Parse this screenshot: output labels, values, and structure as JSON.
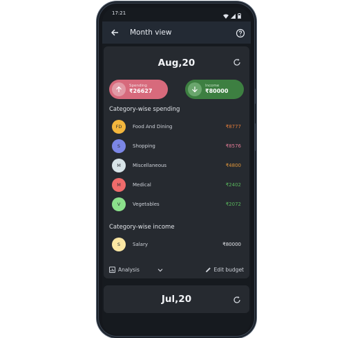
{
  "status_bar": {
    "time": "17:21"
  },
  "app_bar": {
    "title": "Month view"
  },
  "month_card": {
    "month": "Aug,20",
    "spending": {
      "label": "Spending",
      "amount": "₹26627",
      "color": "#d76a7c"
    },
    "income": {
      "label": "Income",
      "amount": "₹80000",
      "color": "#3d7f41"
    },
    "spending_section_title": "Category-wise spending",
    "spending_categories": [
      {
        "initials": "FD",
        "name": "Food And Dining",
        "amount": "₹8777",
        "badge_color": "#f3b63d",
        "amount_color": "#e07b3a"
      },
      {
        "initials": "S",
        "name": "Shopping",
        "amount": "₹8576",
        "badge_color": "#7b86e6",
        "amount_color": "#e07a95"
      },
      {
        "initials": "M",
        "name": "Miscellaneous",
        "amount": "₹4800",
        "badge_color": "#d8e4e8",
        "amount_color": "#e0963a"
      },
      {
        "initials": "M",
        "name": "Medical",
        "amount": "₹2402",
        "badge_color": "#ef6b6b",
        "amount_color": "#59b65c"
      },
      {
        "initials": "V",
        "name": "Vegetables",
        "amount": "₹2072",
        "badge_color": "#8be08b",
        "amount_color": "#59b65c"
      }
    ],
    "income_section_title": "Category-wise income",
    "income_categories": [
      {
        "initials": "S",
        "name": "Salary",
        "amount": "₹80000",
        "badge_color": "#fbe7a3",
        "amount_color": "#e6e8ec"
      }
    ],
    "actions": {
      "analysis_label": "Analysis",
      "edit_label": "Edit budget"
    }
  },
  "next_card": {
    "month": "Jul,20"
  }
}
